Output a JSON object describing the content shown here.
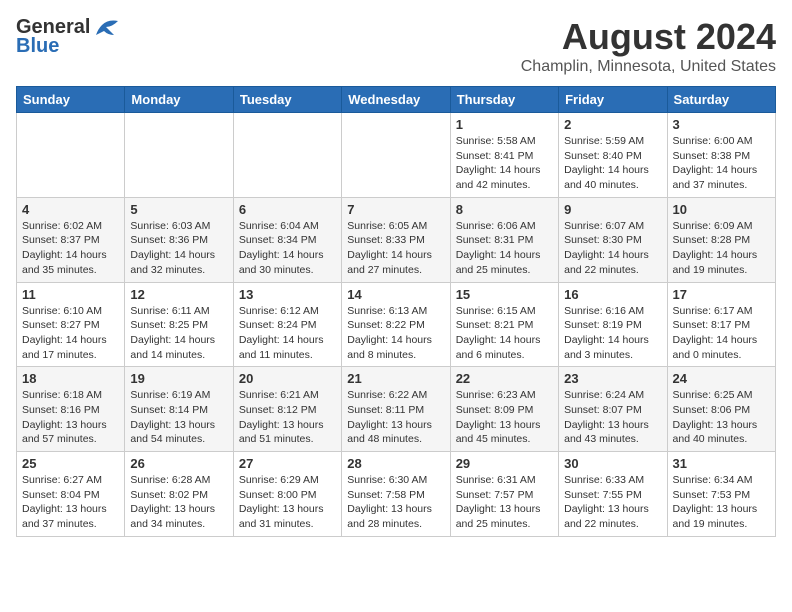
{
  "header": {
    "logo_general": "General",
    "logo_blue": "Blue",
    "month_year": "August 2024",
    "location": "Champlin, Minnesota, United States"
  },
  "days_of_week": [
    "Sunday",
    "Monday",
    "Tuesday",
    "Wednesday",
    "Thursday",
    "Friday",
    "Saturday"
  ],
  "weeks": [
    [
      {
        "day": "",
        "info": ""
      },
      {
        "day": "",
        "info": ""
      },
      {
        "day": "",
        "info": ""
      },
      {
        "day": "",
        "info": ""
      },
      {
        "day": "1",
        "info": "Sunrise: 5:58 AM\nSunset: 8:41 PM\nDaylight: 14 hours and 42 minutes."
      },
      {
        "day": "2",
        "info": "Sunrise: 5:59 AM\nSunset: 8:40 PM\nDaylight: 14 hours and 40 minutes."
      },
      {
        "day": "3",
        "info": "Sunrise: 6:00 AM\nSunset: 8:38 PM\nDaylight: 14 hours and 37 minutes."
      }
    ],
    [
      {
        "day": "4",
        "info": "Sunrise: 6:02 AM\nSunset: 8:37 PM\nDaylight: 14 hours and 35 minutes."
      },
      {
        "day": "5",
        "info": "Sunrise: 6:03 AM\nSunset: 8:36 PM\nDaylight: 14 hours and 32 minutes."
      },
      {
        "day": "6",
        "info": "Sunrise: 6:04 AM\nSunset: 8:34 PM\nDaylight: 14 hours and 30 minutes."
      },
      {
        "day": "7",
        "info": "Sunrise: 6:05 AM\nSunset: 8:33 PM\nDaylight: 14 hours and 27 minutes."
      },
      {
        "day": "8",
        "info": "Sunrise: 6:06 AM\nSunset: 8:31 PM\nDaylight: 14 hours and 25 minutes."
      },
      {
        "day": "9",
        "info": "Sunrise: 6:07 AM\nSunset: 8:30 PM\nDaylight: 14 hours and 22 minutes."
      },
      {
        "day": "10",
        "info": "Sunrise: 6:09 AM\nSunset: 8:28 PM\nDaylight: 14 hours and 19 minutes."
      }
    ],
    [
      {
        "day": "11",
        "info": "Sunrise: 6:10 AM\nSunset: 8:27 PM\nDaylight: 14 hours and 17 minutes."
      },
      {
        "day": "12",
        "info": "Sunrise: 6:11 AM\nSunset: 8:25 PM\nDaylight: 14 hours and 14 minutes."
      },
      {
        "day": "13",
        "info": "Sunrise: 6:12 AM\nSunset: 8:24 PM\nDaylight: 14 hours and 11 minutes."
      },
      {
        "day": "14",
        "info": "Sunrise: 6:13 AM\nSunset: 8:22 PM\nDaylight: 14 hours and 8 minutes."
      },
      {
        "day": "15",
        "info": "Sunrise: 6:15 AM\nSunset: 8:21 PM\nDaylight: 14 hours and 6 minutes."
      },
      {
        "day": "16",
        "info": "Sunrise: 6:16 AM\nSunset: 8:19 PM\nDaylight: 14 hours and 3 minutes."
      },
      {
        "day": "17",
        "info": "Sunrise: 6:17 AM\nSunset: 8:17 PM\nDaylight: 14 hours and 0 minutes."
      }
    ],
    [
      {
        "day": "18",
        "info": "Sunrise: 6:18 AM\nSunset: 8:16 PM\nDaylight: 13 hours and 57 minutes."
      },
      {
        "day": "19",
        "info": "Sunrise: 6:19 AM\nSunset: 8:14 PM\nDaylight: 13 hours and 54 minutes."
      },
      {
        "day": "20",
        "info": "Sunrise: 6:21 AM\nSunset: 8:12 PM\nDaylight: 13 hours and 51 minutes."
      },
      {
        "day": "21",
        "info": "Sunrise: 6:22 AM\nSunset: 8:11 PM\nDaylight: 13 hours and 48 minutes."
      },
      {
        "day": "22",
        "info": "Sunrise: 6:23 AM\nSunset: 8:09 PM\nDaylight: 13 hours and 45 minutes."
      },
      {
        "day": "23",
        "info": "Sunrise: 6:24 AM\nSunset: 8:07 PM\nDaylight: 13 hours and 43 minutes."
      },
      {
        "day": "24",
        "info": "Sunrise: 6:25 AM\nSunset: 8:06 PM\nDaylight: 13 hours and 40 minutes."
      }
    ],
    [
      {
        "day": "25",
        "info": "Sunrise: 6:27 AM\nSunset: 8:04 PM\nDaylight: 13 hours and 37 minutes."
      },
      {
        "day": "26",
        "info": "Sunrise: 6:28 AM\nSunset: 8:02 PM\nDaylight: 13 hours and 34 minutes."
      },
      {
        "day": "27",
        "info": "Sunrise: 6:29 AM\nSunset: 8:00 PM\nDaylight: 13 hours and 31 minutes."
      },
      {
        "day": "28",
        "info": "Sunrise: 6:30 AM\nSunset: 7:58 PM\nDaylight: 13 hours and 28 minutes."
      },
      {
        "day": "29",
        "info": "Sunrise: 6:31 AM\nSunset: 7:57 PM\nDaylight: 13 hours and 25 minutes."
      },
      {
        "day": "30",
        "info": "Sunrise: 6:33 AM\nSunset: 7:55 PM\nDaylight: 13 hours and 22 minutes."
      },
      {
        "day": "31",
        "info": "Sunrise: 6:34 AM\nSunset: 7:53 PM\nDaylight: 13 hours and 19 minutes."
      }
    ]
  ]
}
